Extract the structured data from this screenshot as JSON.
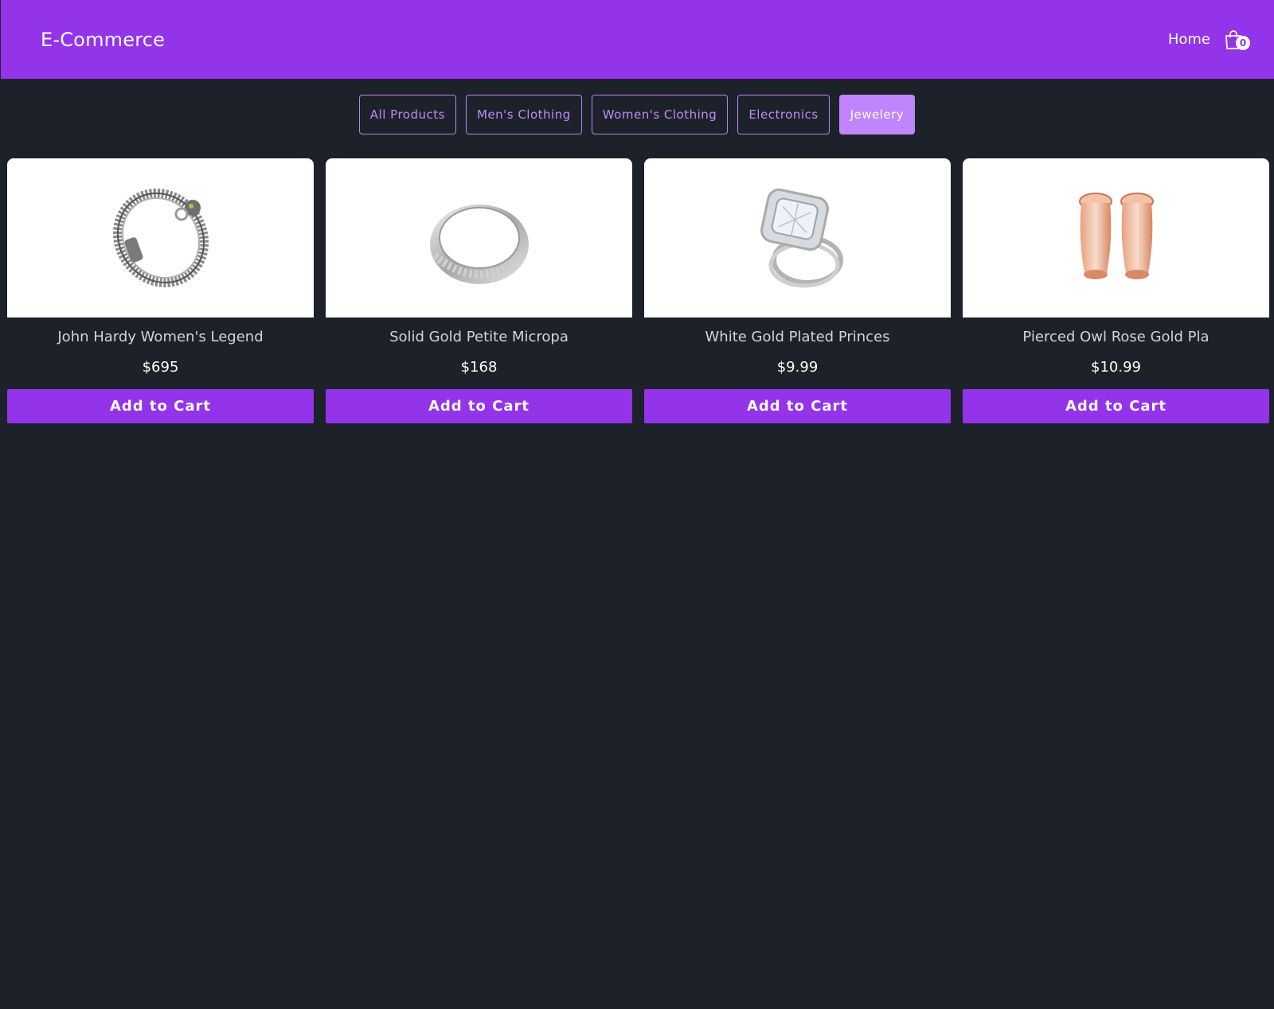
{
  "navbar": {
    "brand": "E-Commerce",
    "home_label": "Home",
    "cart_count": "0",
    "cart_icon": "shopping-bag-icon"
  },
  "filters": [
    {
      "label": "All Products",
      "active": false
    },
    {
      "label": "Men's Clothing",
      "active": false
    },
    {
      "label": "Women's Clothing",
      "active": false
    },
    {
      "label": "Electronics",
      "active": false
    },
    {
      "label": "Jewelery",
      "active": true
    }
  ],
  "products": [
    {
      "title": "John Hardy Women's Legend",
      "price": "$695",
      "button": "Add to Cart",
      "image": "silver-chain-bracelet"
    },
    {
      "title": "Solid Gold Petite Micropa",
      "price": "$168",
      "button": "Add to Cart",
      "image": "silver-band-ring"
    },
    {
      "title": "White Gold Plated Princes",
      "price": "$9.99",
      "button": "Add to Cart",
      "image": "diamond-engagement-ring"
    },
    {
      "title": "Pierced Owl Rose Gold Pla",
      "price": "$10.99",
      "button": "Add to Cart",
      "image": "rose-gold-tunnel-earrings"
    }
  ],
  "colors": {
    "brand_purple": "#9333ea",
    "active_filter": "#c084fc",
    "background": "#1d222a"
  }
}
